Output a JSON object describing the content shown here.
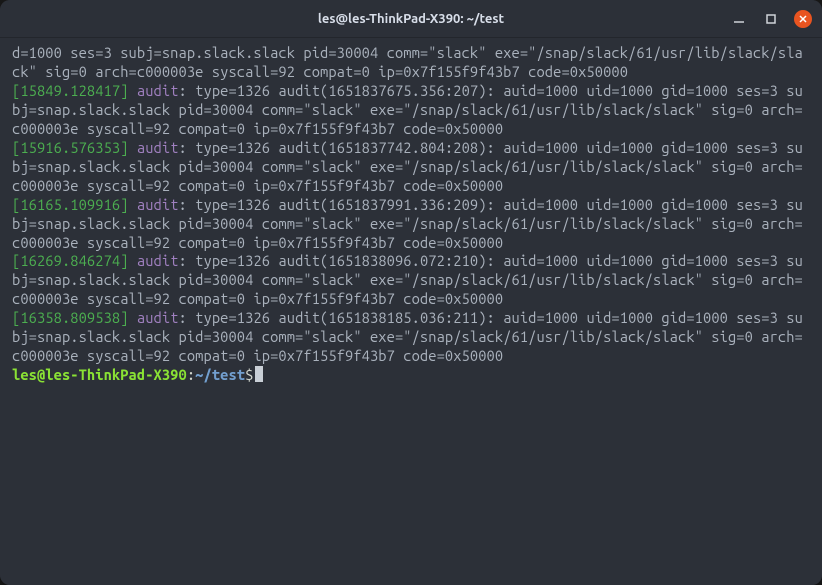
{
  "titlebar": {
    "title": "les@les-ThinkPad-X390: ~/test"
  },
  "terminal": {
    "partial_head": "d=1000 ses=3 subj=snap.slack.slack pid=30004 comm=\"slack\" exe=\"/snap/slack/61/usr/lib/slack/slack\" sig=0 arch=c000003e syscall=92 compat=0 ip=0x7f155f9f43b7 code=0x50000",
    "entries": [
      {
        "ts": "[15849.128417]",
        "tag": "audit",
        "body": ": type=1326 audit(1651837675.356:207): auid=1000 uid=1000 gid=1000 ses=3 subj=snap.slack.slack pid=30004 comm=\"slack\" exe=\"/snap/slack/61/usr/lib/slack/slack\" sig=0 arch=c000003e syscall=92 compat=0 ip=0x7f155f9f43b7 code=0x50000"
      },
      {
        "ts": "[15916.576353]",
        "tag": "audit",
        "body": ": type=1326 audit(1651837742.804:208): auid=1000 uid=1000 gid=1000 ses=3 subj=snap.slack.slack pid=30004 comm=\"slack\" exe=\"/snap/slack/61/usr/lib/slack/slack\" sig=0 arch=c000003e syscall=92 compat=0 ip=0x7f155f9f43b7 code=0x50000"
      },
      {
        "ts": "[16165.109916]",
        "tag": "audit",
        "body": ": type=1326 audit(1651837991.336:209): auid=1000 uid=1000 gid=1000 ses=3 subj=snap.slack.slack pid=30004 comm=\"slack\" exe=\"/snap/slack/61/usr/lib/slack/slack\" sig=0 arch=c000003e syscall=92 compat=0 ip=0x7f155f9f43b7 code=0x50000"
      },
      {
        "ts": "[16269.846274]",
        "tag": "audit",
        "body": ": type=1326 audit(1651838096.072:210): auid=1000 uid=1000 gid=1000 ses=3 subj=snap.slack.slack pid=30004 comm=\"slack\" exe=\"/snap/slack/61/usr/lib/slack/slack\" sig=0 arch=c000003e syscall=92 compat=0 ip=0x7f155f9f43b7 code=0x50000"
      },
      {
        "ts": "[16358.809538]",
        "tag": "audit",
        "body": ": type=1326 audit(1651838185.036:211): auid=1000 uid=1000 gid=1000 ses=3 subj=snap.slack.slack pid=30004 comm=\"slack\" exe=\"/snap/slack/61/usr/lib/slack/slack\" sig=0 arch=c000003e syscall=92 compat=0 ip=0x7f155f9f43b7 code=0x50000"
      }
    ],
    "prompt": {
      "userhost": "les@les-ThinkPad-X390",
      "colon": ":",
      "path": "~/test",
      "dollar": "$"
    }
  }
}
